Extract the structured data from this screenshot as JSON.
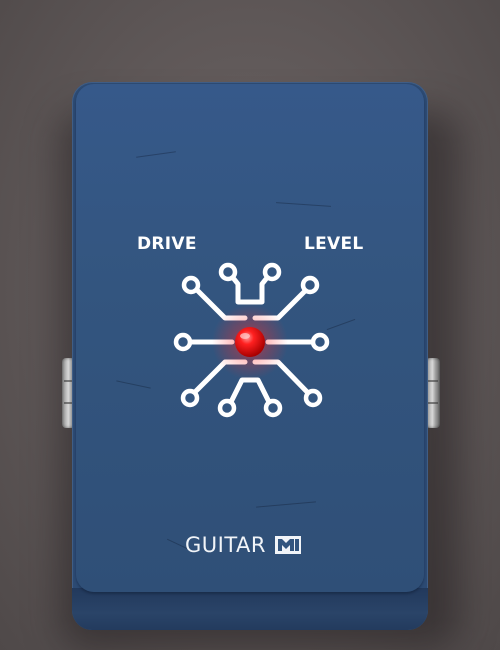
{
  "pedal": {
    "left_knob_label": "DRIVE",
    "right_knob_label": "LEVEL",
    "brand_name": "GUITAR",
    "brand_mark_icon": "m-logo-icon",
    "enclosure_color": "#33557f",
    "led_color": "#ff1a1a"
  }
}
